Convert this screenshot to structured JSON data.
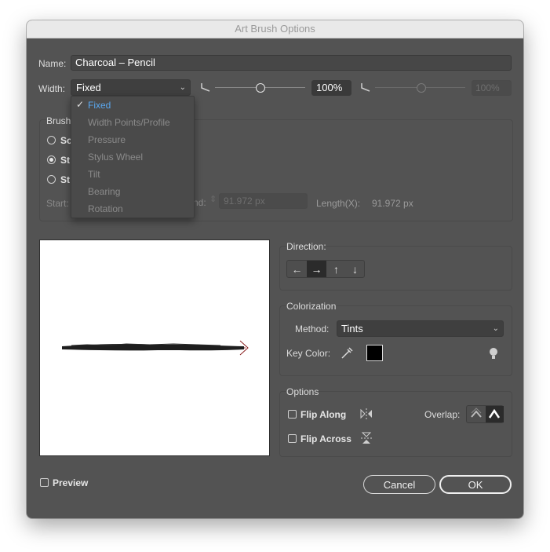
{
  "dialog": {
    "title": "Art Brush Options"
  },
  "name_field": {
    "label": "Name:",
    "value": "Charcoal – Pencil"
  },
  "width": {
    "label": "Width:",
    "selected": "Fixed",
    "percent": "100%",
    "secondary_percent": "100%",
    "options": [
      "Fixed",
      "Width Points/Profile",
      "Pressure",
      "Stylus Wheel",
      "Tilt",
      "Bearing",
      "Rotation"
    ]
  },
  "brush_scale": {
    "label_partial": "Brush",
    "options_partial": [
      "Sc",
      "St",
      "St"
    ],
    "start_label_partial": "Start:",
    "end_label_partial": "nd:",
    "end_value": "91.972 px",
    "length_label": "Length(X):",
    "length_value": "91.972 px"
  },
  "direction": {
    "label": "Direction:",
    "icons": [
      "arrow-left-icon",
      "arrow-right-icon",
      "arrow-up-icon",
      "arrow-down-icon"
    ]
  },
  "colorization": {
    "label": "Colorization",
    "method_label": "Method:",
    "method_value": "Tints",
    "key_color_label": "Key Color:",
    "key_color": "#000000"
  },
  "options": {
    "label": "Options",
    "flip_along": "Flip Along",
    "flip_across": "Flip Across",
    "overlap_label": "Overlap:"
  },
  "footer": {
    "preview_label": "Preview",
    "cancel": "Cancel",
    "ok": "OK"
  },
  "colors": {
    "dialog_bg": "#535353",
    "accent": "#5aa8f0",
    "stroke": "#8b2020"
  }
}
